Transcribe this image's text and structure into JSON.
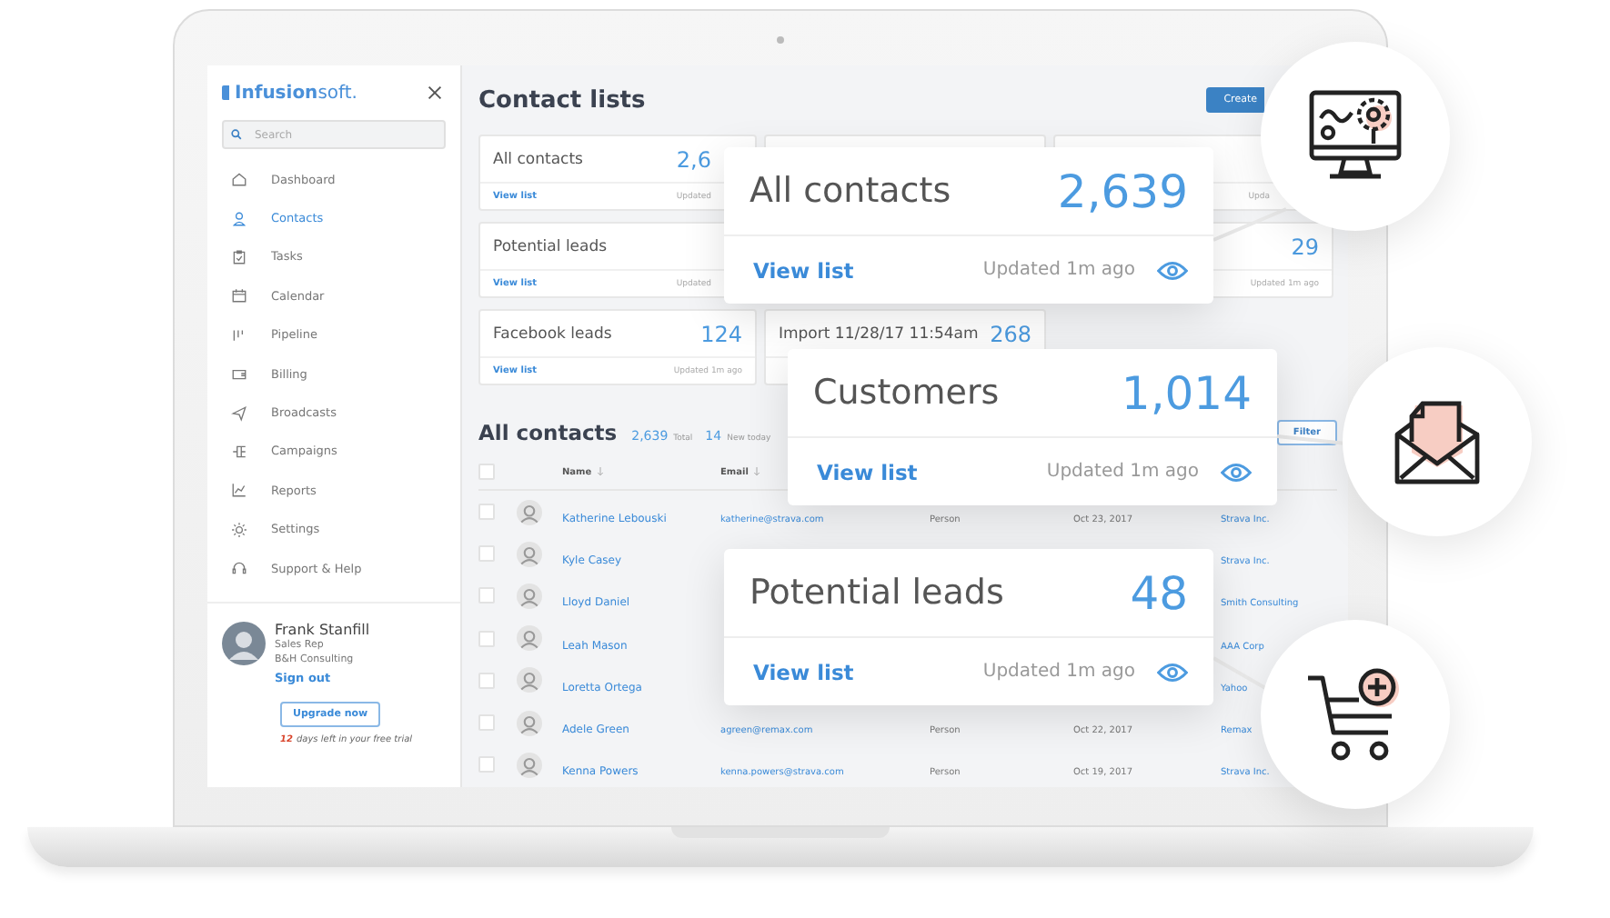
{
  "sidebar": {
    "logo": "**Infusion**soft.",
    "search": {
      "placeholder": "Search"
    },
    "items": [
      {
        "label": "Dashboard",
        "selected": false
      },
      {
        "label": "Contacts",
        "selected": true
      },
      {
        "label": "Tasks",
        "selected": false
      },
      {
        "label": "Calendar",
        "selected": false
      },
      {
        "label": "Pipeline",
        "selected": false
      },
      {
        "label": "Billing",
        "selected": false
      },
      {
        "label": "Broadcasts",
        "selected": false
      },
      {
        "label": "Campaigns",
        "selected": false
      },
      {
        "label": "Reports",
        "selected": false
      },
      {
        "label": "Settings",
        "selected": false
      },
      {
        "label": "Support & Help",
        "selected": false
      }
    ],
    "profile": {
      "name": "Frank Stanfill",
      "role": "Sales Rep",
      "company": "B&H Consulting",
      "sign_out": "Sign out"
    },
    "upgrade_button": "Upgrade now",
    "trial": {
      "days": "12",
      "text": "days left in your free trial"
    }
  },
  "main": {
    "title": "Contact lists",
    "create_button": "Create",
    "cards": [
      {
        "kind": "list",
        "title": "All contacts",
        "count": "2,6",
        "link": "View list",
        "updated": "Updated"
      },
      {
        "kind": "covered"
      },
      {
        "kind": "list",
        "updated": "Upda"
      },
      {
        "kind": "list",
        "title": "Potential leads",
        "link": "View list",
        "updated": "Updated"
      },
      {
        "kind": "hidden"
      },
      {
        "kind": "list",
        "count": "29",
        "updated": "Updated 1m ago"
      },
      {
        "kind": "list",
        "title": "Facebook leads",
        "count": "124",
        "link": "View list",
        "updated": "Updated 1m ago"
      },
      {
        "kind": "list",
        "title": "Import 11/28/17 11:54am",
        "count": "268"
      }
    ],
    "contacts": {
      "title": "All contacts",
      "total": "2,639",
      "total_label": "Total",
      "new": "14",
      "new_label": "New today",
      "filter_button": "Filter",
      "select_all": {
        "checked": false
      },
      "columns": [
        {
          "label": "Name"
        },
        {
          "label": "Email"
        }
      ],
      "rows": [
        {
          "checked": false,
          "name": "Katherine Lebouski",
          "email": "katherine@strava.com",
          "type": "Person",
          "date": "Oct 23, 2017",
          "company": "Strava Inc."
        },
        {
          "checked": false,
          "name": "Kyle Casey",
          "company": "Strava Inc."
        },
        {
          "checked": false,
          "name": "Lloyd Daniel",
          "company": "Smith Consulting"
        },
        {
          "checked": false,
          "name": "Leah Mason",
          "company": "AAA Corp"
        },
        {
          "checked": false,
          "name": "Loretta Ortega",
          "company": "Yahoo"
        },
        {
          "checked": false,
          "name": "Adele Green",
          "email": "agreen@remax.com",
          "type": "Person",
          "date": "Oct 22, 2017",
          "company": "Remax"
        },
        {
          "checked": false,
          "name": "Kenna Powers",
          "email": "kenna.powers@strava.com",
          "type": "Person",
          "date": "Oct 19, 2017",
          "company": "Strava Inc."
        }
      ]
    }
  },
  "popups": [
    {
      "title": "All contacts",
      "count": "2,639",
      "link": "View list",
      "updated": "Updated 1m ago"
    },
    {
      "title": "Customers",
      "count": "1,014",
      "link": "View list",
      "updated": "Updated 1m ago"
    },
    {
      "title": "Potential leads",
      "count": "48",
      "link": "View list",
      "updated": "Updated 1m ago"
    }
  ]
}
